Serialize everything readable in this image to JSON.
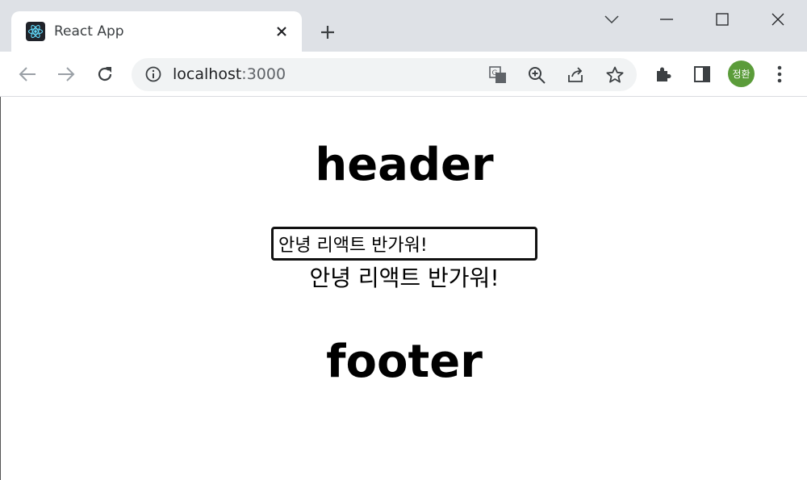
{
  "browser": {
    "tab": {
      "title": "React App",
      "favicon": "react-logo-icon"
    },
    "address_bar": {
      "host": "localhost",
      "port": ":3000"
    },
    "profile": {
      "initials": "정환",
      "color": "#5b9c3a"
    }
  },
  "page": {
    "header": "header",
    "input": {
      "value": "안녕 리액트 반가워!"
    },
    "echo_text": "안녕 리액트 반가워!",
    "footer": "footer"
  }
}
